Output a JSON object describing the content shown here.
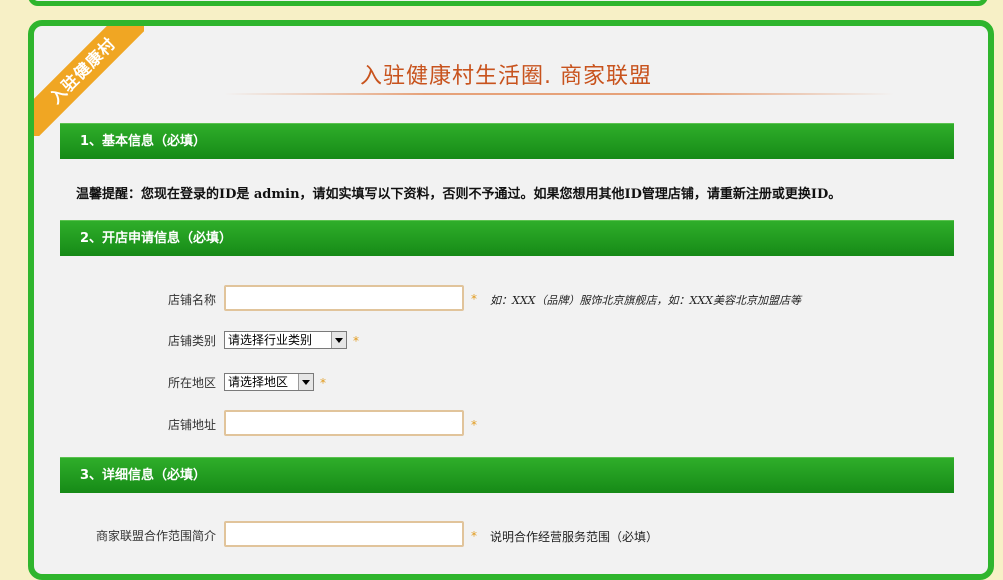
{
  "ribbon": {
    "label": "入驻健康村"
  },
  "page": {
    "title": "入驻健康村生活圈. 商家联盟"
  },
  "sections": [
    {
      "label": "1、基本信息（必填）"
    },
    {
      "label": "2、开店申请信息（必填）"
    },
    {
      "label": "3、详细信息（必填）"
    }
  ],
  "notice": {
    "text": "温馨提醒：您现在登录的ID是 admin，请如实填写以下资料，否则不予通过。如果您想用其他ID管理店铺，请重新注册或更换ID。"
  },
  "form": {
    "required_mark": "*",
    "store_name": {
      "label": "店铺名称",
      "value": "",
      "hint": "如：XXX（品牌）服饰北京旗舰店，如：XXX美容北京加盟店等"
    },
    "store_category": {
      "label": "店铺类别",
      "selected": "请选择行业类别"
    },
    "region": {
      "label": "所在地区",
      "selected": "请选择地区"
    },
    "store_address": {
      "label": "店铺地址",
      "value": ""
    },
    "alliance_scope": {
      "label": "商家联盟合作范围简介",
      "value": "",
      "hint": "说明合作经营服务范围（必填）"
    }
  },
  "colors": {
    "brand_green": "#2fb52d",
    "title_orange": "#c8531d",
    "star_orange": "#e29b1e",
    "ribbon": "#f0a623"
  }
}
